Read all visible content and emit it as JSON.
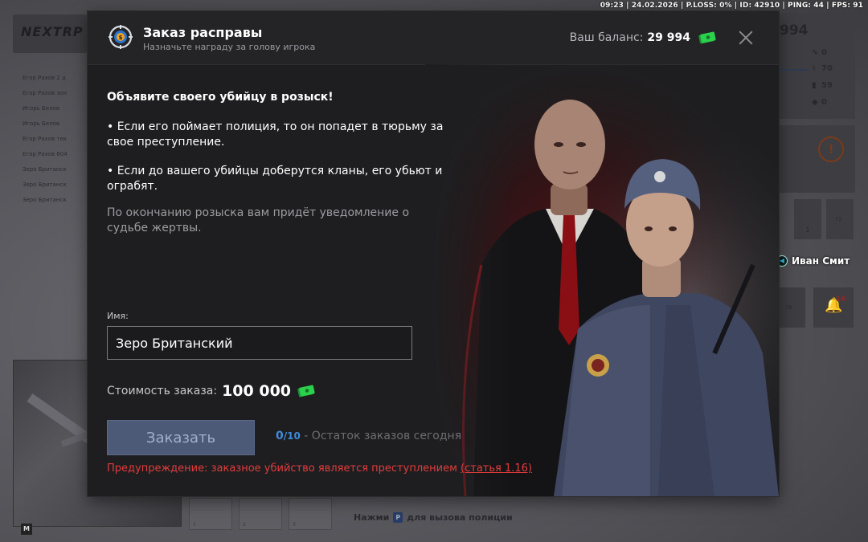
{
  "status_bar": "09:23 | 24.02.2026 | P.LOSS: 0% | ID: 42910 | PING: 44 | FPS: 91",
  "background": {
    "logo": "NEXTRP",
    "list_rows": [
      "Егор Рахов 2 д",
      "Егор Рахов зон",
      "Игорь Белов",
      "Игорь Белов",
      "Егор Рахов тек",
      "Егор Рахов 604",
      "Зеро Британск",
      "Зеро Британск",
      "Зеро Британск"
    ],
    "hud": {
      "money": "994",
      "stats": [
        "0",
        "70",
        "59",
        "0"
      ],
      "slot_keys": [
        "F2",
        "F8"
      ],
      "slot_count": "1",
      "notifications": "16"
    },
    "voice_player": "Иван Смит",
    "inventory_slots": [
      "1",
      "2",
      "3"
    ],
    "minimap_key": "M",
    "hint_prefix": "Нажми",
    "hint_key": "P",
    "hint_suffix": "для вызова полиции"
  },
  "modal": {
    "title": "Заказ расправы",
    "subtitle": "Назначьте награду за голову игрока",
    "balance_label": "Ваш баланс:",
    "balance_value": "29 994",
    "heading": "Объявите своего убийцу в розыск!",
    "bullet_1": "•  Если его поймает полиция, то он попадет в тюрьму за свое преступление.",
    "bullet_2": "•  Если до вашего убийцы доберутся кланы, его убьют и ограбят.",
    "note": "По окончанию розыска вам придёт уведомление о судьбе жертвы.",
    "name_label": "Имя:",
    "name_value": "Зеро Британский",
    "price_label": "Стоимость заказа:",
    "price_value": "100 000",
    "order_button": "Заказать",
    "orders_used": "0",
    "orders_total": "/10",
    "orders_text": " - Остаток заказов сегодня",
    "warning_text": "Предупреждение: заказное убийство является преступлением ",
    "warning_link": "(статья 1.16)"
  },
  "colors": {
    "modal_bg": "#1e1e20",
    "accent_blue": "#3f8ad8",
    "button_bg": "#4c5a78",
    "warning_red": "#e23c3c",
    "money_green": "#2bd14c"
  }
}
